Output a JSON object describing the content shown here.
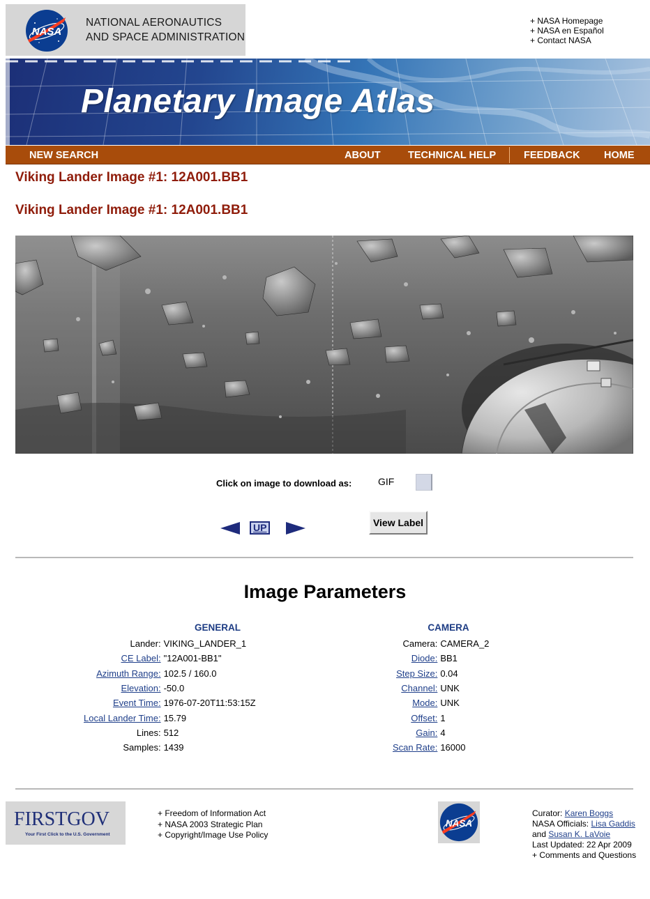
{
  "header": {
    "agency_line1": "NATIONAL AERONAUTICS",
    "agency_line2": "AND SPACE ADMINISTRATION",
    "logo_text": "NASA",
    "top_links": [
      "+ NASA Homepage",
      "+ NASA en Español",
      "+ Contact NASA"
    ],
    "banner_title": "Planetary Image Atlas"
  },
  "nav": {
    "new_search": "NEW SEARCH",
    "about": "ABOUT",
    "technical_help": "TECHNICAL HELP",
    "feedback": "FEEDBACK",
    "home": "HOME"
  },
  "titles": {
    "heading1": "Viking Lander Image #1: 12A001.BB1",
    "heading2": "Viking Lander Image #1: 12A001.BB1"
  },
  "download": {
    "label": "Click on image to download as:",
    "format": "GIF"
  },
  "navigation": {
    "up_label": "UP",
    "view_label_button": "View Label"
  },
  "parameters": {
    "title": "Image Parameters",
    "general": {
      "heading": "GENERAL",
      "rows": [
        {
          "key": "Lander:",
          "value": "VIKING_LANDER_1",
          "link": false
        },
        {
          "key": "CE Label:",
          "value": "\"12A001-BB1\"",
          "link": true
        },
        {
          "key": "Azimuth Range:",
          "value": "102.5 / 160.0",
          "link": true
        },
        {
          "key": "Elevation:",
          "value": "-50.0",
          "link": true
        },
        {
          "key": "Event Time:",
          "value": "1976-07-20T11:53:15Z",
          "link": true
        },
        {
          "key": "Local Lander Time:",
          "value": "15.79",
          "link": true
        },
        {
          "key": "Lines:",
          "value": "512",
          "link": false
        },
        {
          "key": "Samples:",
          "value": "1439",
          "link": false
        }
      ]
    },
    "camera": {
      "heading": "CAMERA",
      "rows": [
        {
          "key": "Camera:",
          "value": "CAMERA_2",
          "link": false
        },
        {
          "key": "Diode:",
          "value": "BB1",
          "link": true
        },
        {
          "key": "Step Size:",
          "value": "0.04",
          "link": true
        },
        {
          "key": "Channel:",
          "value": "UNK",
          "link": true
        },
        {
          "key": "Mode:",
          "value": "UNK",
          "link": true
        },
        {
          "key": "Offset:",
          "value": "1",
          "link": true
        },
        {
          "key": "Gain:",
          "value": "4",
          "link": true
        },
        {
          "key": "Scan Rate:",
          "value": "16000",
          "link": true
        }
      ]
    }
  },
  "footer": {
    "firstgov_name": "FIRSTGOV",
    "firstgov_tagline": "Your First Click to the U.S. Government",
    "links": [
      "+ Freedom of Information Act",
      "+ NASA 2003 Strategic Plan",
      "+ Copyright/Image Use Policy"
    ],
    "curator_label": "Curator:",
    "curator_name": "Karen Boggs",
    "officials_label": "NASA Officials:",
    "official_1": "Lisa Gaddis",
    "and_label": "and",
    "official_2": "Susan K. LaVoie",
    "last_updated": "Last Updated: 22 Apr 2009",
    "comments": "+ Comments and Questions"
  },
  "colors": {
    "nav_bar": "#a84c0b",
    "title_red": "#8f1c0a",
    "link_blue": "#1f3f8a",
    "column_heading_blue": "#1d3c84",
    "nasa_blue": "#0b3d91",
    "nasa_red": "#fc3d21"
  },
  "icons": {
    "prev": "left-triangle-arrow",
    "next": "right-triangle-arrow",
    "logo": "nasa-meatball"
  }
}
